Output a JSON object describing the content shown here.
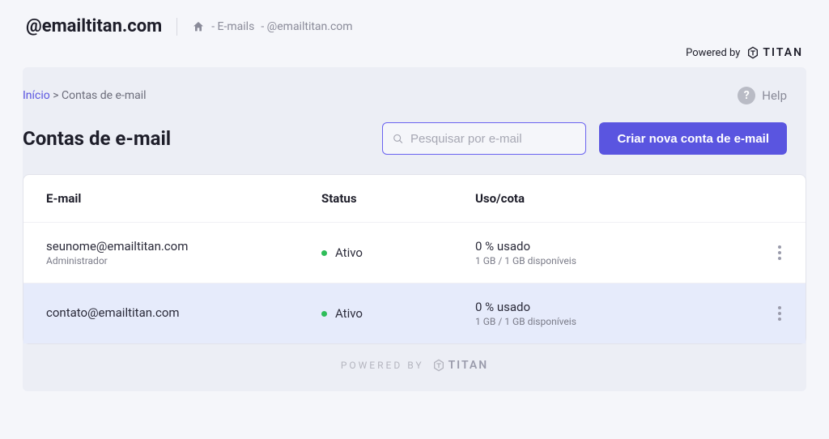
{
  "header": {
    "domain": "@emailtitan.com",
    "crumb1": "- E-mails",
    "crumb2": "- @emailtitan.com",
    "powered_by": "Powered by",
    "brand": "TITAN"
  },
  "breadcrumbs": {
    "start": "Início",
    "sep": ">",
    "current": "Contas de e-mail"
  },
  "help_label": "Help",
  "page_title": "Contas de e-mail",
  "search": {
    "placeholder": "Pesquisar por e-mail"
  },
  "primary_button": "Criar nova conta de e-mail",
  "table": {
    "headers": {
      "email": "E-mail",
      "status": "Status",
      "usage": "Uso/cota"
    },
    "rows": [
      {
        "email": "seunome@emailtitan.com",
        "role": "Administrador",
        "status": "Ativo",
        "usage_main": "0 % usado",
        "usage_sub": "1 GB / 1 GB disponíveis"
      },
      {
        "email": "contato@emailtitan.com",
        "role": "",
        "status": "Ativo",
        "usage_main": "0 % usado",
        "usage_sub": "1 GB / 1 GB disponíveis"
      }
    ]
  },
  "footer": {
    "powered_by": "POWERED BY",
    "brand": "TITAN"
  }
}
